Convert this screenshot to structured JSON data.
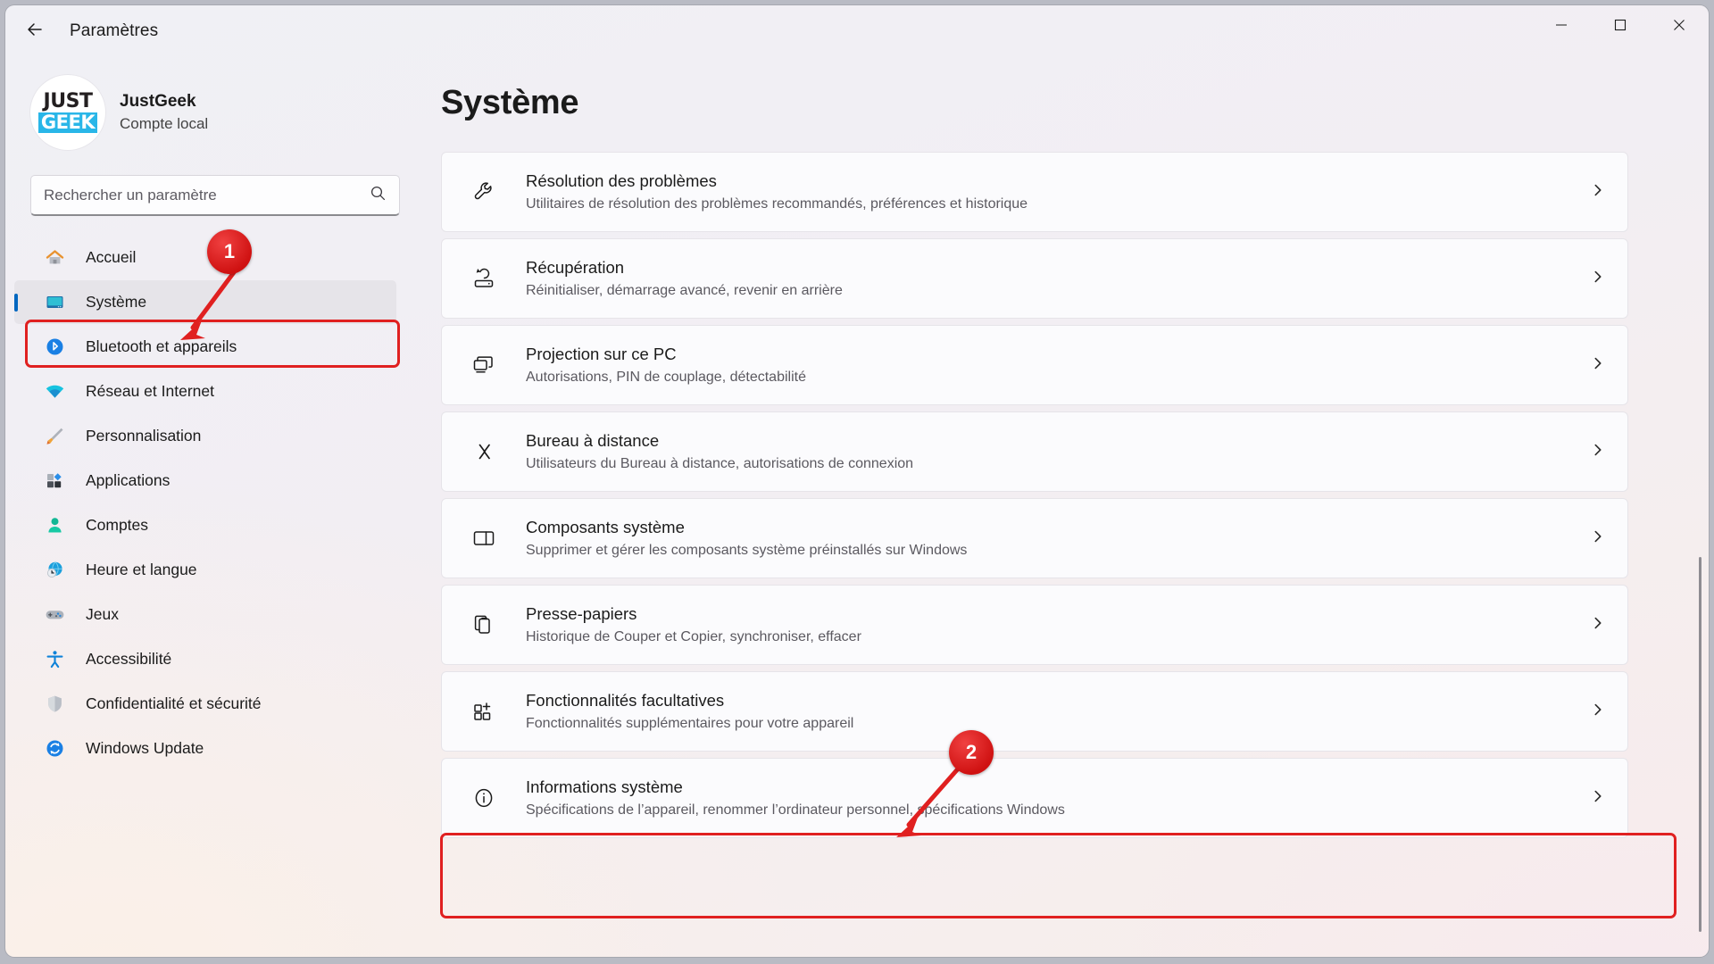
{
  "window": {
    "title": "Paramètres",
    "back_icon": "arrow-left-icon",
    "controls": {
      "minimize": "minimize-icon",
      "maximize": "maximize-icon",
      "close": "close-icon"
    }
  },
  "account": {
    "logo_top": "JUST",
    "logo_bottom": "GEEK",
    "name": "JustGeek",
    "type": "Compte local"
  },
  "search": {
    "placeholder": "Rechercher un paramètre",
    "value": "",
    "icon": "search-icon"
  },
  "sidebar": {
    "items": [
      {
        "label": "Accueil",
        "icon": "home-icon",
        "selected": false
      },
      {
        "label": "Système",
        "icon": "monitor-icon",
        "selected": true
      },
      {
        "label": "Bluetooth et appareils",
        "icon": "bluetooth-icon",
        "selected": false
      },
      {
        "label": "Réseau et Internet",
        "icon": "wifi-icon",
        "selected": false
      },
      {
        "label": "Personnalisation",
        "icon": "paintbrush-icon",
        "selected": false
      },
      {
        "label": "Applications",
        "icon": "apps-icon",
        "selected": false
      },
      {
        "label": "Comptes",
        "icon": "person-icon",
        "selected": false
      },
      {
        "label": "Heure et langue",
        "icon": "globe-clock-icon",
        "selected": false
      },
      {
        "label": "Jeux",
        "icon": "gamepad-icon",
        "selected": false
      },
      {
        "label": "Accessibilité",
        "icon": "accessibility-icon",
        "selected": false
      },
      {
        "label": "Confidentialité et sécurité",
        "icon": "shield-icon",
        "selected": false
      },
      {
        "label": "Windows Update",
        "icon": "refresh-icon",
        "selected": false
      }
    ]
  },
  "main": {
    "title": "Système",
    "cards": [
      {
        "title": "Résolution des problèmes",
        "sub": "Utilitaires de résolution des problèmes recommandés, préférences et historique",
        "icon": "wrench-icon",
        "chevron": "chevron-right-icon",
        "highlighted": false
      },
      {
        "title": "Récupération",
        "sub": "Réinitialiser, démarrage avancé, revenir en arrière",
        "icon": "recovery-icon",
        "chevron": "chevron-right-icon",
        "highlighted": false
      },
      {
        "title": "Projection sur ce PC",
        "sub": "Autorisations, PIN de couplage, détectabilité",
        "icon": "project-screen-icon",
        "chevron": "chevron-right-icon",
        "highlighted": false
      },
      {
        "title": "Bureau à distance",
        "sub": "Utilisateurs du Bureau à distance, autorisations de connexion",
        "icon": "remote-desktop-icon",
        "chevron": "chevron-right-icon",
        "highlighted": false
      },
      {
        "title": "Composants système",
        "sub": "Supprimer et gérer les composants système préinstallés sur Windows",
        "icon": "system-components-icon",
        "chevron": "chevron-right-icon",
        "highlighted": false
      },
      {
        "title": "Presse-papiers",
        "sub": "Historique de Couper et Copier, synchroniser, effacer",
        "icon": "clipboard-icon",
        "chevron": "chevron-right-icon",
        "highlighted": false
      },
      {
        "title": "Fonctionnalités facultatives",
        "sub": "Fonctionnalités supplémentaires pour votre appareil",
        "icon": "optional-features-icon",
        "chevron": "chevron-right-icon",
        "highlighted": false
      },
      {
        "title": "Informations système",
        "sub": "Spécifications de l’appareil, renommer l’ordinateur personnel, spécifications Windows",
        "icon": "info-icon",
        "chevron": "chevron-right-icon",
        "highlighted": true
      }
    ]
  },
  "annotations": {
    "badges": [
      {
        "label": "1",
        "target": "sidebar-item-systeme"
      },
      {
        "label": "2",
        "target": "card-informations-systeme"
      }
    ],
    "color": "#e02020"
  }
}
